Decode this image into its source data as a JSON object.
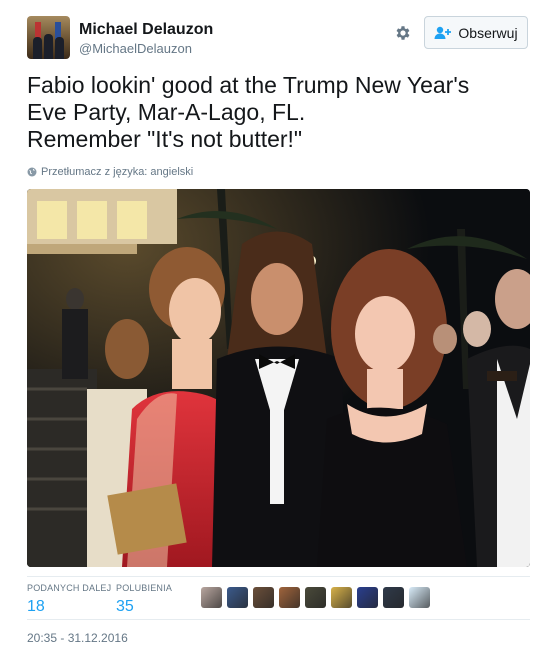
{
  "author": {
    "name": "Michael Delauzon",
    "handle": "@MichaelDelauzon"
  },
  "follow_button": {
    "label": "Obserwuj"
  },
  "tweet": {
    "lines": [
      "Fabio lookin' good at the Trump New Year's",
      "Eve Party, Mar-A-Lago, FL.",
      "Remember \"It's not butter!\""
    ],
    "translate_label": "Przetłumacz z języka: angielski"
  },
  "stats": {
    "retweets": {
      "label": "PODANYCH DALEJ",
      "value": "18"
    },
    "likes": {
      "label": "POLUBIENIA",
      "value": "35"
    }
  },
  "likers": [
    {
      "color": "#b9a7a0"
    },
    {
      "color": "#3b5a8c"
    },
    {
      "color": "#6b4f3a"
    },
    {
      "color": "#a0643c"
    },
    {
      "color": "#4a4a3a"
    },
    {
      "color": "#d8b24a"
    },
    {
      "color": "#2a3f8f"
    },
    {
      "color": "#2f3a4a"
    },
    {
      "color": "#d9ecf9"
    }
  ],
  "timestamp": "20:35 - 31.12.2016",
  "colors": {
    "accent": "#1da1f2",
    "secondary_text": "#657786",
    "border": "#e6ecf0"
  }
}
